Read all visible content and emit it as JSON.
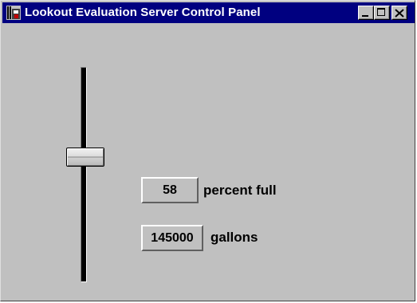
{
  "window": {
    "title": "Lookout Evaluation Server Control Panel",
    "app_icon": "lookout-app-icon",
    "buttons": {
      "minimize_icon": "minimize-icon",
      "maximize_icon": "maximize-icon",
      "close_icon": "close-icon"
    }
  },
  "tank": {
    "level_percent": 58,
    "percent_value": "58",
    "percent_label": "percent full",
    "gallons_value": "145000",
    "gallons_label": "gallons"
  },
  "colors": {
    "titlebar": "#000080",
    "panel": "#c0c0c0"
  }
}
